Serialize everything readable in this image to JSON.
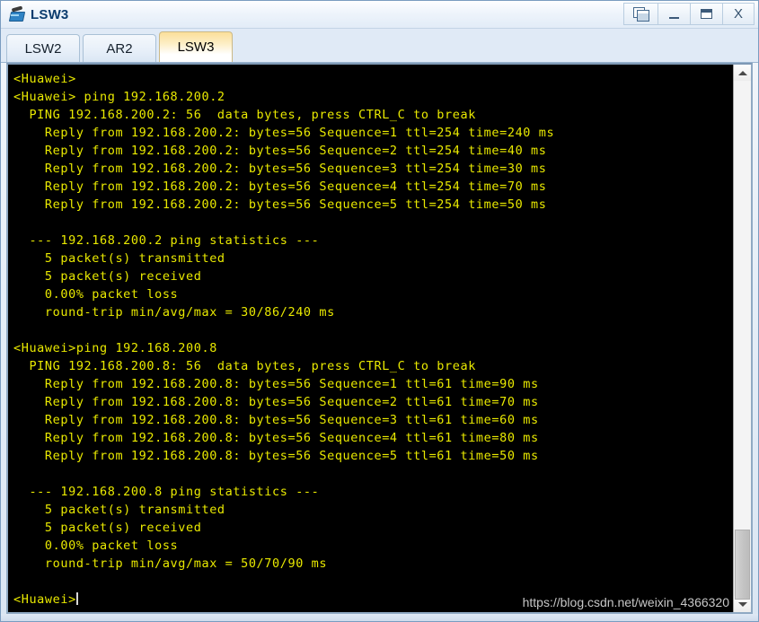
{
  "window": {
    "title": "LSW3",
    "app_icon": "switch-icon",
    "buttons": [
      {
        "name": "cascade-windows-button",
        "label": ""
      },
      {
        "name": "minimize-button",
        "label": ""
      },
      {
        "name": "maximize-button",
        "label": ""
      },
      {
        "name": "close-button",
        "label": "X"
      }
    ]
  },
  "tabs": [
    {
      "label": "LSW2",
      "active": false
    },
    {
      "label": "AR2",
      "active": false
    },
    {
      "label": "LSW3",
      "active": true
    }
  ],
  "terminal": {
    "text_color": "#e9e900",
    "background_color": "#000000",
    "lines": [
      "<Huawei>",
      "<Huawei> ping 192.168.200.2",
      "  PING 192.168.200.2: 56  data bytes, press CTRL_C to break",
      "    Reply from 192.168.200.2: bytes=56 Sequence=1 ttl=254 time=240 ms",
      "    Reply from 192.168.200.2: bytes=56 Sequence=2 ttl=254 time=40 ms",
      "    Reply from 192.168.200.2: bytes=56 Sequence=3 ttl=254 time=30 ms",
      "    Reply from 192.168.200.2: bytes=56 Sequence=4 ttl=254 time=70 ms",
      "    Reply from 192.168.200.2: bytes=56 Sequence=5 ttl=254 time=50 ms",
      "",
      "  --- 192.168.200.2 ping statistics ---",
      "    5 packet(s) transmitted",
      "    5 packet(s) received",
      "    0.00% packet loss",
      "    round-trip min/avg/max = 30/86/240 ms",
      "",
      "<Huawei>ping 192.168.200.8",
      "  PING 192.168.200.8: 56  data bytes, press CTRL_C to break",
      "    Reply from 192.168.200.8: bytes=56 Sequence=1 ttl=61 time=90 ms",
      "    Reply from 192.168.200.8: bytes=56 Sequence=2 ttl=61 time=70 ms",
      "    Reply from 192.168.200.8: bytes=56 Sequence=3 ttl=61 time=60 ms",
      "    Reply from 192.168.200.8: bytes=56 Sequence=4 ttl=61 time=80 ms",
      "    Reply from 192.168.200.8: bytes=56 Sequence=5 ttl=61 time=50 ms",
      "",
      "  --- 192.168.200.8 ping statistics ---",
      "    5 packet(s) transmitted",
      "    5 packet(s) received",
      "    0.00% packet loss",
      "    round-trip min/avg/max = 50/70/90 ms",
      ""
    ],
    "prompt_line": "<Huawei>",
    "watermark": "https://blog.csdn.net/weixin_4366320"
  },
  "scrollbar": {
    "up_arrow": "chevron-up-icon",
    "down_arrow": "chevron-down-icon"
  }
}
